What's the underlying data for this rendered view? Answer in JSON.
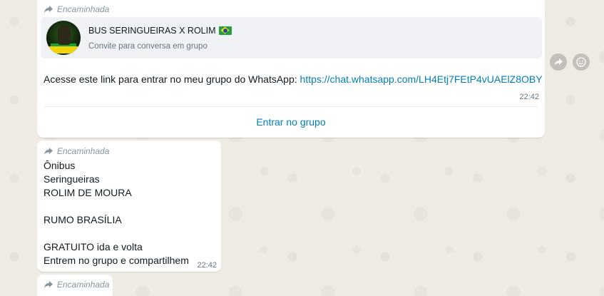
{
  "messages": {
    "invite": {
      "forwarded_label": "Encaminhada",
      "group_name": "BUS SERINGUEIRAS X ROLIM",
      "group_subtitle": "Convite para conversa em grupo",
      "text_prefix": "Acesse este link para entrar no meu grupo do WhatsApp: ",
      "link": "https://chat.whatsapp.com/LH4Etj7FEtP4vUAElZ8OBY",
      "time": "22:42",
      "action_label": "Entrar no grupo"
    },
    "bus": {
      "forwarded_label": "Encaminhada",
      "text": "Ônibus\nSeringueiras\nROLIM DE MOURA\n\nRUMO BRASÍLIA\n\nGRATUITO ida e volta\nEntrem no grupo e compartilhem",
      "time": "22:42"
    },
    "third": {
      "forwarded_label": "Encaminhada"
    }
  },
  "icons": {
    "forward": "forward-arrow-icon",
    "share": "share-icon",
    "emoji": "emoji-icon",
    "flag": "brazil-flag-icon"
  },
  "colors": {
    "background": "#efeae2",
    "bubble": "#ffffff",
    "link": "#027eb5",
    "meta": "#8696a0"
  }
}
